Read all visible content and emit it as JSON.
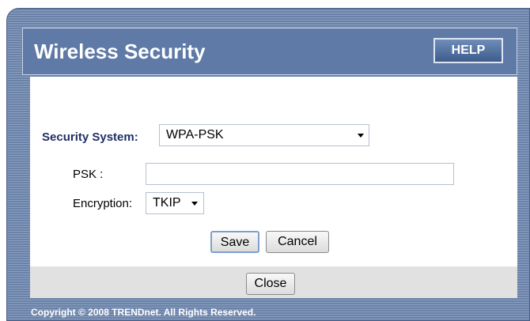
{
  "dialog": {
    "title": "Wireless Security",
    "help_label": "HELP"
  },
  "security_system": {
    "label": "Security System:",
    "selected": "WPA-PSK"
  },
  "psk": {
    "label": "PSK :",
    "value": ""
  },
  "encryption": {
    "label": "Encryption:",
    "selected": "TKIP"
  },
  "actions": {
    "save_label": "Save",
    "cancel_label": "Cancel",
    "close_label": "Close"
  },
  "footer": {
    "copyright": "Copyright © 2008 TRENDnet. All Rights Reserved."
  },
  "colors": {
    "header_bg": "#5f7aa6",
    "label_blue": "#1f2f66"
  }
}
